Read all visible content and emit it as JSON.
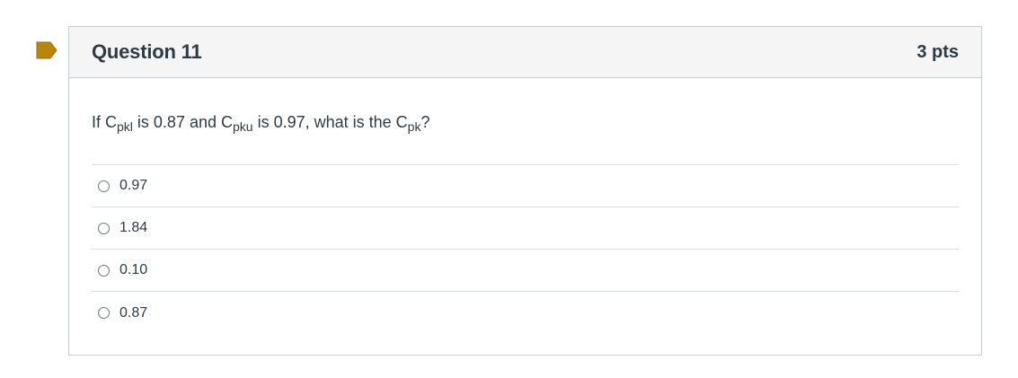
{
  "question": {
    "title": "Question 11",
    "points": "3 pts",
    "text_parts": {
      "p1": "If C",
      "sub1": "pkl",
      "p2": " is 0.87 and C",
      "sub2": "pku",
      "p3": " is 0.97, what is the C",
      "sub3": "pk",
      "p4": "?"
    },
    "answers": [
      {
        "label": "0.97"
      },
      {
        "label": "1.84"
      },
      {
        "label": "0.10"
      },
      {
        "label": "0.87"
      }
    ]
  },
  "icons": {
    "flag": "bookmark-flag-icon",
    "radio": "radio-unchecked-icon"
  },
  "colors": {
    "flag": "#b8860b",
    "header_bg": "#f5f5f5",
    "border": "#c7cdd1",
    "text": "#2d3b45"
  }
}
